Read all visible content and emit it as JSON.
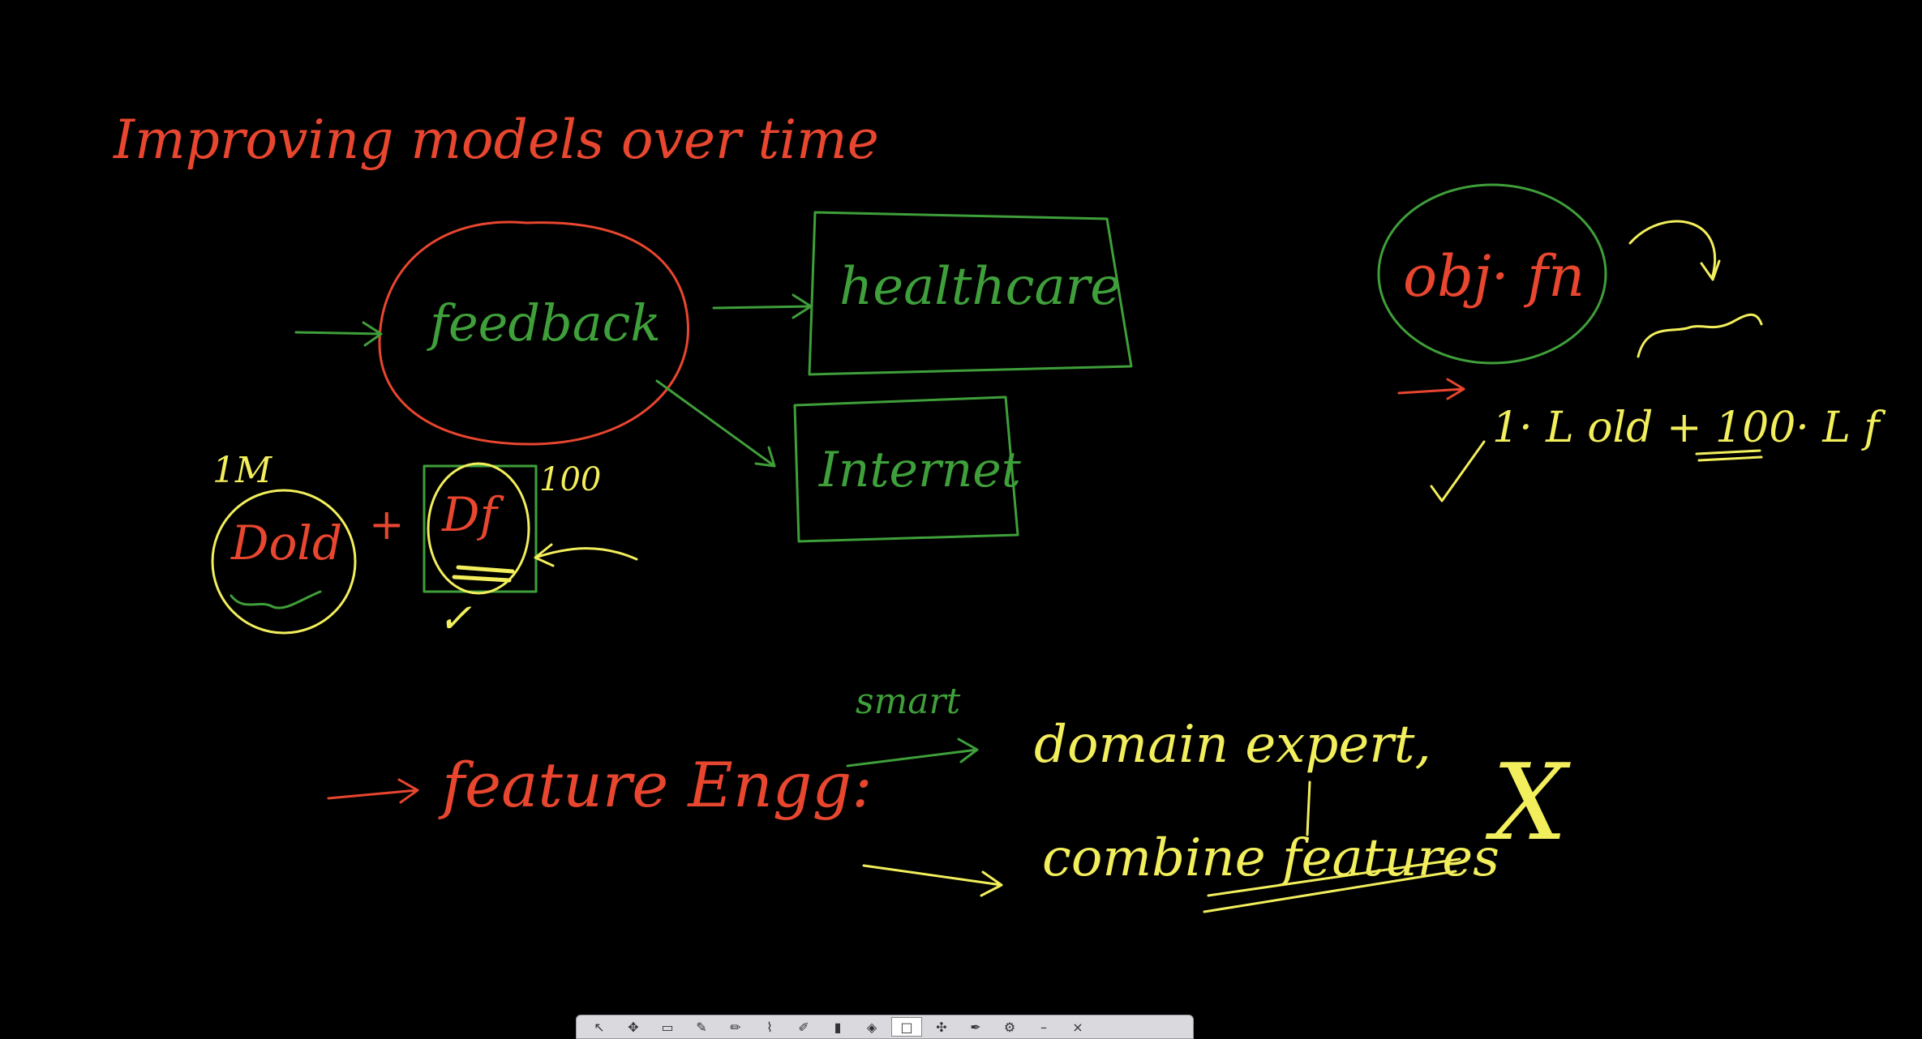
{
  "colors": {
    "background": "#000000",
    "red": "#e8462f",
    "green": "#3f9f3a",
    "yellow": "#f2ee5c"
  },
  "title": "Improving models over time",
  "nodes": {
    "feedback": "feedback",
    "healthcare": "healthcare",
    "internet": "Internet",
    "obj_fn": "obj· fn"
  },
  "notes": {
    "one_m": "1M",
    "d_old": "Dold",
    "plus": "+",
    "d_f": "Df",
    "hundred": "100",
    "loss_formula": "1· L old + 100· L f",
    "feature_engg": "feature Engg:",
    "smart": "smart",
    "domain_expert": "domain expert,",
    "combine_features": "combine features",
    "cross": "X",
    "check": "✓"
  },
  "toolbar": {
    "tools": [
      "pointer-icon",
      "grab-icon",
      "eraser-icon",
      "pen-icon",
      "pen-icon",
      "brush-icon",
      "pencil-icon",
      "highlighter-icon",
      "marker-icon",
      "select-icon",
      "arrow-icon",
      "pen-icon",
      "gear-icon",
      "minimize-icon",
      "close-icon"
    ],
    "glyphs": [
      "↖",
      "✥",
      "▭",
      "✎",
      "✏",
      "⌇",
      "✐",
      "▮",
      "◈",
      "□",
      "✣",
      "✒",
      "⚙",
      "–",
      "×"
    ]
  }
}
